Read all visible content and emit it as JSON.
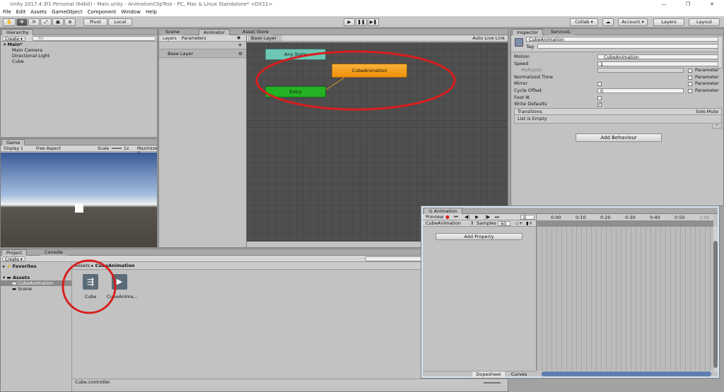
{
  "window": {
    "title": "Unity 2017.4.3f1 Personal (64bit) - Main.unity - AnimationClipTest - PC, Mac & Linux Standalone* <DX11>"
  },
  "menu": [
    "File",
    "Edit",
    "Assets",
    "GameObject",
    "Component",
    "Window",
    "Help"
  ],
  "toolbar": {
    "pivot": "Pivot",
    "local": "Local",
    "collab": "Collab ▾",
    "account": "Account ▾",
    "layers": "Layers",
    "layout": "Layout"
  },
  "hierarchy": {
    "tab": "Hierarchy",
    "create": "Create ▾",
    "search_placeholder": "All",
    "scene": "Main*",
    "items": [
      "Main Camera",
      "Directional Light",
      "Cube"
    ]
  },
  "animator": {
    "tabs": [
      "Scene",
      "Animator",
      "Asset Store"
    ],
    "layers_tab": "Layers",
    "params_tab": "Parameters",
    "breadcrumb": "Base Layer",
    "auto_live": "Auto Live Link",
    "layer_name": "Base Layer",
    "states": {
      "any": "Any State",
      "cube": "CubeAnimation",
      "entry": "Entry"
    }
  },
  "game": {
    "tab": "Game",
    "display": "Display 1",
    "aspect": "Free Aspect",
    "scale": "Scale",
    "scale_val": "1x",
    "maximize": "Maximize O"
  },
  "project": {
    "tabs": [
      "Project",
      "Console"
    ],
    "create": "Create ▾",
    "favorites": "Favorites",
    "assets": "Assets",
    "tree": [
      "CubeAnimation",
      "Scene"
    ],
    "breadcrumb_root": "Assets ▸",
    "breadcrumb_leaf": "CubeAnimation",
    "files": [
      "Cube",
      "CubeAnima..."
    ],
    "footer": "Cube.controller"
  },
  "inspector": {
    "tabs": [
      "Inspector",
      "Services"
    ],
    "name": "CubeAnimation",
    "tag_label": "Tag",
    "rows": [
      {
        "label": "Motion",
        "value": "CubeAnimation"
      },
      {
        "label": "Speed",
        "value": "1"
      },
      {
        "label": "Multiplier",
        "value": ""
      },
      {
        "label": "Normalized Time",
        "value": ""
      },
      {
        "label": "Mirror",
        "value": ""
      },
      {
        "label": "Cycle Offset",
        "value": "0"
      },
      {
        "label": "Foot IK",
        "value": ""
      },
      {
        "label": "Write Defaults",
        "value": ""
      }
    ],
    "parameter": "Parameter",
    "transitions": "Transitions",
    "solo": "Solo",
    "mute": "Mute",
    "empty": "List is Empty",
    "minus": "−",
    "add_behaviour": "Add Behaviour"
  },
  "animation": {
    "tab": "Animation",
    "preview": "Preview",
    "frame": "0",
    "clip": "CubeAnimation",
    "samples_label": "Samples",
    "samples": "60",
    "add_property": "Add Property",
    "ticks": [
      "0:00",
      "0:10",
      "0:20",
      "0:30",
      "0:40",
      "0:50",
      "1:00"
    ],
    "dopesheet": "Dopesheet",
    "curves": "Curves"
  },
  "colors": {
    "any_state": "#6ec6b5",
    "cube_state": "#f6a21c",
    "entry_state": "#23b223",
    "annotation": "#d81e1e"
  }
}
